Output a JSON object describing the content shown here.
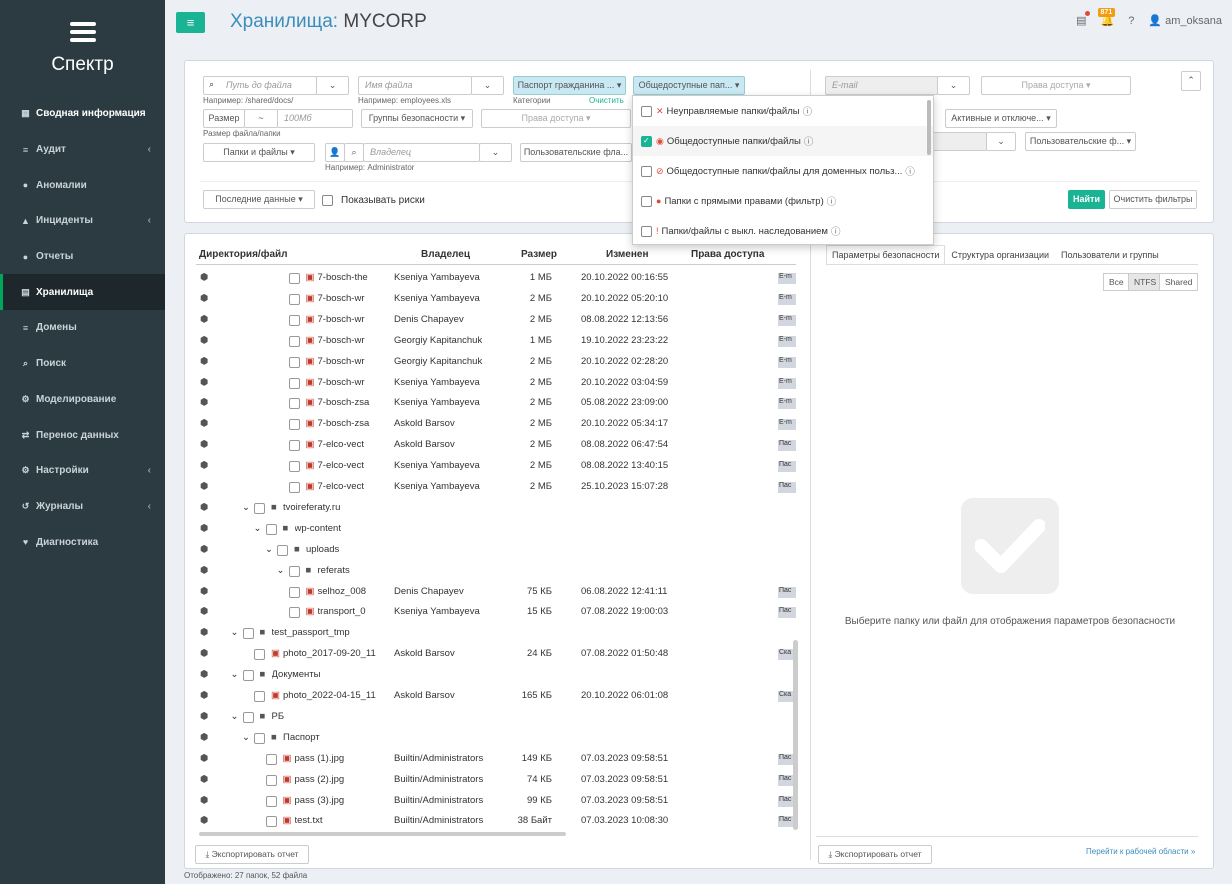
{
  "app": {
    "name": "Спектр"
  },
  "sidebar": {
    "items": [
      {
        "label": "Сводная информация",
        "icon": "dashboard-icon",
        "arrow": false
      },
      {
        "label": "Аудит",
        "icon": "list-icon",
        "arrow": true
      },
      {
        "label": "Аномалии",
        "icon": "alert-circle-icon",
        "arrow": false
      },
      {
        "label": "Инциденты",
        "icon": "bell-icon",
        "arrow": true
      },
      {
        "label": "Отчеты",
        "icon": "report-icon",
        "arrow": false
      },
      {
        "label": "Хранилища",
        "icon": "storage-icon",
        "arrow": false
      },
      {
        "label": "Домены",
        "icon": "domains-icon",
        "arrow": false
      },
      {
        "label": "Поиск",
        "icon": "search-icon",
        "arrow": false
      },
      {
        "label": "Моделирование",
        "icon": "model-icon",
        "arrow": false
      },
      {
        "label": "Перенос данных",
        "icon": "shuffle-icon",
        "arrow": false
      },
      {
        "label": "Настройки",
        "icon": "gear-icon",
        "arrow": true
      },
      {
        "label": "Журналы",
        "icon": "history-icon",
        "arrow": true
      },
      {
        "label": "Диагностика",
        "icon": "heartbeat-icon",
        "arrow": false
      }
    ]
  },
  "header": {
    "title_prefix": "Хранилища:",
    "title_name": "MYCORP",
    "notif_count": "871",
    "user": "am_oksana",
    "menu_glyph": "≡"
  },
  "filters": {
    "path_placeholder": "Путь до файла",
    "path_hint": "Например: /shared/docs/",
    "name_placeholder": "Имя файла",
    "name_hint": "Например: employees.xls",
    "category_value": "Паспорт гражданина ...",
    "category_label": "Категории",
    "clear_label": "Очистить",
    "public_value": "Общедоступные пап...",
    "email_placeholder": "E-mail",
    "rights_right": "Права доступа",
    "size_label": "Размер",
    "size_placeholder": "100Мб",
    "size_hint": "Размер файла/папки",
    "sec_groups": "Группы безопасности",
    "rights_left": "Права доступа",
    "active_filter": "Активные и отключе...",
    "user_attrs": "Пользовательские ф...",
    "files_folders": "Папки и файлы",
    "owner_placeholder": "Владелец",
    "owner_hint": "Например: Administrator",
    "user_flags": "Пользовательские фла...",
    "last_data": "Последние данные",
    "show_risks": "Показывать риски",
    "find": "Найти",
    "clear_filters": "Очистить фильтры",
    "dropdown": [
      {
        "label": "Неуправляемые папки/файлы",
        "checked": false,
        "icon": "unmanaged-icon"
      },
      {
        "label": "Общедоступные папки/файлы",
        "checked": true,
        "icon": "eye-icon"
      },
      {
        "label": "Общедоступные папки/файлы для доменных польз...",
        "checked": false,
        "icon": "unlock-icon"
      },
      {
        "label": "Папки с прямыми правами (фильтр)",
        "checked": false,
        "icon": "user-icon"
      },
      {
        "label": "Папки/файлы с выкл. наследованием",
        "checked": false,
        "icon": "exclamation-icon"
      }
    ]
  },
  "table": {
    "headers": [
      "Директория/файл",
      "Владелец",
      "Размер",
      "Изменен",
      "Права доступа"
    ],
    "rows": [
      {
        "indent": 5,
        "name": "7-bosch-the",
        "owner": "Kseniya Yambayeva",
        "size": "1 МБ",
        "date": "20.10.2022 00:16:55",
        "tag": "E-m",
        "type": "file"
      },
      {
        "indent": 5,
        "name": "7-bosch-wr",
        "owner": "Kseniya Yambayeva",
        "size": "2 МБ",
        "date": "20.10.2022 05:20:10",
        "tag": "E-m",
        "type": "file"
      },
      {
        "indent": 5,
        "name": "7-bosch-wr",
        "owner": "Denis Chapayev",
        "size": "2 МБ",
        "date": "08.08.2022 12:13:56",
        "tag": "E-m",
        "type": "file"
      },
      {
        "indent": 5,
        "name": "7-bosch-wr",
        "owner": "Georgiy Kapitanchuk",
        "size": "1 МБ",
        "date": "19.10.2022 23:23:22",
        "tag": "E-m",
        "type": "file"
      },
      {
        "indent": 5,
        "name": "7-bosch-wr",
        "owner": "Georgiy Kapitanchuk",
        "size": "2 МБ",
        "date": "20.10.2022 02:28:20",
        "tag": "E-m",
        "type": "file"
      },
      {
        "indent": 5,
        "name": "7-bosch-wr",
        "owner": "Kseniya Yambayeva",
        "size": "2 МБ",
        "date": "20.10.2022 03:04:59",
        "tag": "E-m",
        "type": "file"
      },
      {
        "indent": 5,
        "name": "7-bosch-zsa",
        "owner": "Kseniya Yambayeva",
        "size": "2 МБ",
        "date": "05.08.2022 23:09:00",
        "tag": "E-m",
        "type": "file"
      },
      {
        "indent": 5,
        "name": "7-bosch-zsa",
        "owner": "Askold Barsov",
        "size": "2 МБ",
        "date": "20.10.2022 05:34:17",
        "tag": "E-m",
        "type": "file"
      },
      {
        "indent": 5,
        "name": "7-elco-vect",
        "owner": "Askold Barsov",
        "size": "2 МБ",
        "date": "08.08.2022 06:47:54",
        "tag": "Пас",
        "type": "file"
      },
      {
        "indent": 5,
        "name": "7-elco-vect",
        "owner": "Kseniya Yambayeva",
        "size": "2 МБ",
        "date": "08.08.2022 13:40:15",
        "tag": "Пас",
        "type": "file"
      },
      {
        "indent": 5,
        "name": "7-elco-vect",
        "owner": "Kseniya Yambayeva",
        "size": "2 МБ",
        "date": "25.10.2023 15:07:28",
        "tag": "Пас",
        "type": "file"
      },
      {
        "indent": 2,
        "name": "tvoireferaty.ru",
        "owner": "",
        "size": "",
        "date": "",
        "tag": "",
        "type": "folder"
      },
      {
        "indent": 3,
        "name": "wp-content",
        "owner": "",
        "size": "",
        "date": "",
        "tag": "",
        "type": "folder"
      },
      {
        "indent": 4,
        "name": "uploads",
        "owner": "",
        "size": "",
        "date": "",
        "tag": "",
        "type": "folder"
      },
      {
        "indent": 5,
        "name": "referats",
        "owner": "",
        "size": "",
        "date": "",
        "tag": "",
        "type": "folder"
      },
      {
        "indent": 5,
        "name": "selhoz_008",
        "owner": "Denis Chapayev",
        "size": "75 КБ",
        "date": "06.08.2022 12:41:11",
        "tag": "Пас",
        "type": "file"
      },
      {
        "indent": 5,
        "name": "transport_0",
        "owner": "Kseniya Yambayeva",
        "size": "15 КБ",
        "date": "07.08.2022 19:00:03",
        "tag": "Пас",
        "type": "file"
      },
      {
        "indent": 1,
        "name": "test_passport_tmp",
        "owner": "",
        "size": "",
        "date": "",
        "tag": "",
        "type": "folder"
      },
      {
        "indent": 2,
        "name": "photo_2017-09-20_11",
        "owner": "Askold Barsov",
        "size": "24 КБ",
        "date": "07.08.2022 01:50:48",
        "tag": "Ска",
        "type": "file"
      },
      {
        "indent": 1,
        "name": "Документы",
        "owner": "",
        "size": "",
        "date": "",
        "tag": "",
        "type": "folder"
      },
      {
        "indent": 2,
        "name": "photo_2022-04-15_11",
        "owner": "Askold Barsov",
        "size": "165 КБ",
        "date": "20.10.2022 06:01:08",
        "tag": "Ска",
        "type": "file"
      },
      {
        "indent": 1,
        "name": "РБ",
        "owner": "",
        "size": "",
        "date": "",
        "tag": "",
        "type": "folder"
      },
      {
        "indent": 2,
        "name": "Паспорт",
        "owner": "",
        "size": "",
        "date": "",
        "tag": "",
        "type": "folder"
      },
      {
        "indent": 3,
        "name": "pass (1).jpg",
        "owner": "Builtin/Administrators",
        "size": "149 КБ",
        "date": "07.03.2023 09:58:51",
        "tag": "Пас",
        "type": "file"
      },
      {
        "indent": 3,
        "name": "pass (2).jpg",
        "owner": "Builtin/Administrators",
        "size": "74 КБ",
        "date": "07.03.2023 09:58:51",
        "tag": "Пас",
        "type": "file"
      },
      {
        "indent": 3,
        "name": "pass (3).jpg",
        "owner": "Builtin/Administrators",
        "size": "99 КБ",
        "date": "07.03.2023 09:58:51",
        "tag": "Пас",
        "type": "file"
      },
      {
        "indent": 3,
        "name": "test.txt",
        "owner": "Builtin/Administrators",
        "size": "38 Байт",
        "date": "07.03.2023 10:08:30",
        "tag": "Пас",
        "type": "file"
      }
    ]
  },
  "right": {
    "tabs": [
      "Параметры безопасности",
      "Структура организации",
      "Пользователи и группы"
    ],
    "segments": [
      "Все",
      "NTFS",
      "Shared"
    ],
    "empty_message": "Выберите папку или файл для отображения параметров безопасности",
    "export": "Экспортировать отчет",
    "workspace_link": "Перейти к рабочей области »"
  },
  "left_export": "Экспортировать отчет",
  "status": "Отображено: 27 папок, 52 файла",
  "colors": {
    "accent": "#1ab394",
    "sidebar": "#2c3b41",
    "title": "#3c8dbc"
  }
}
